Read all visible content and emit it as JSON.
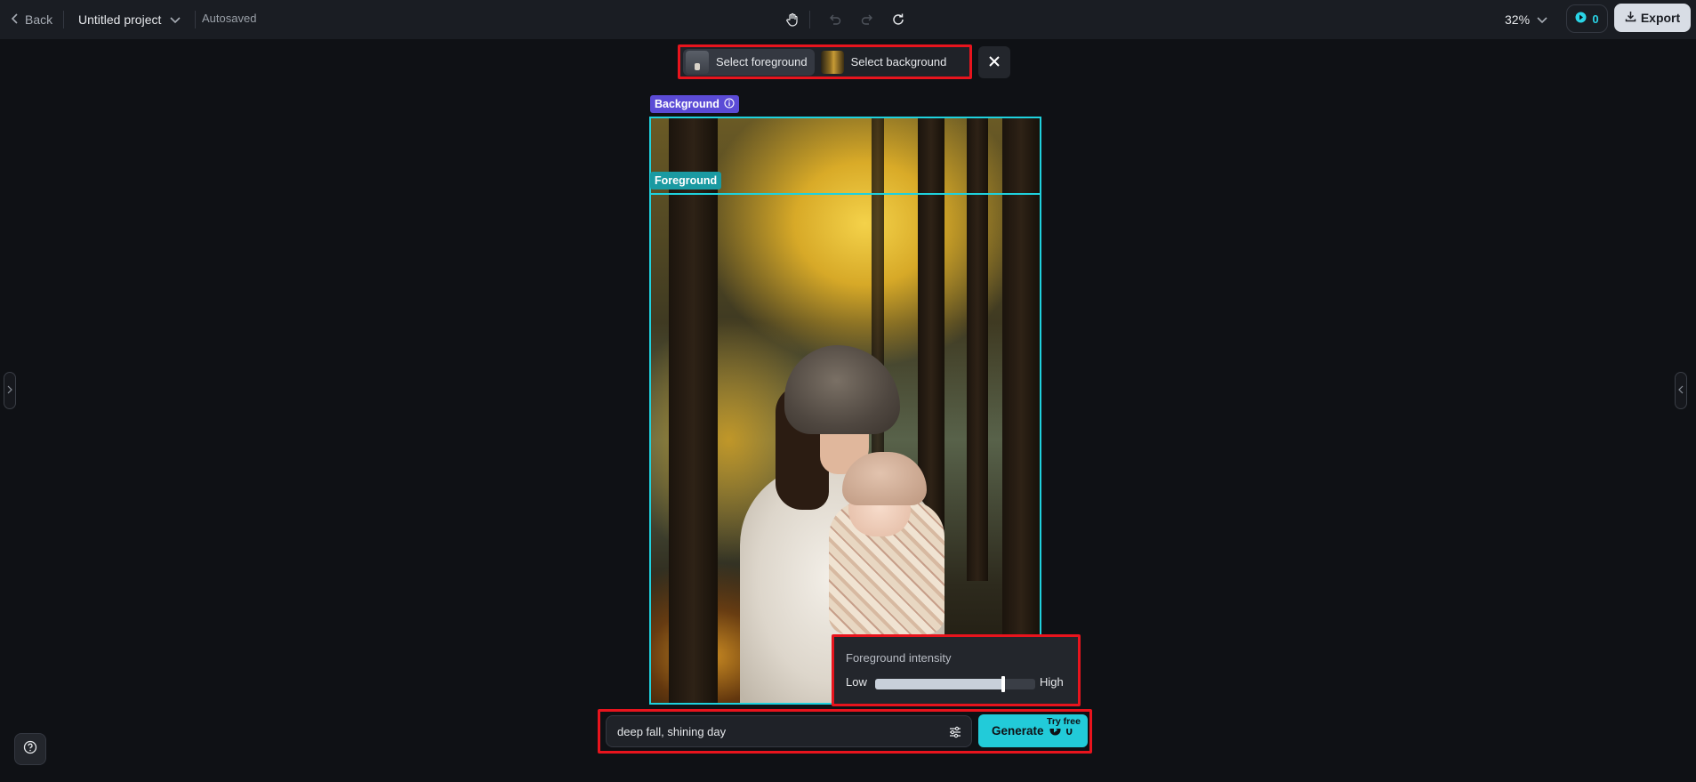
{
  "header": {
    "back_label": "Back",
    "project_title": "Untitled project",
    "autosave_status": "Autosaved",
    "zoom_level": "32%",
    "credits": "0",
    "export_label": "Export"
  },
  "select_toolbar": {
    "foreground_label": "Select foreground",
    "background_label": "Select background"
  },
  "canvas": {
    "background_tag": "Background",
    "foreground_tag": "Foreground"
  },
  "intensity_panel": {
    "title": "Foreground intensity",
    "low_label": "Low",
    "high_label": "High",
    "level_fraction": 0.8
  },
  "prompt": {
    "value": "deep fall, shining day",
    "generate_label": "Generate",
    "generate_cost": "0",
    "try_free_badge": "Try free"
  },
  "colors": {
    "accent": "#22cbd9",
    "highlight_box": "#e8141d",
    "background_tag": "#5b4bd6",
    "foreground_tag": "#1a9aa2"
  }
}
